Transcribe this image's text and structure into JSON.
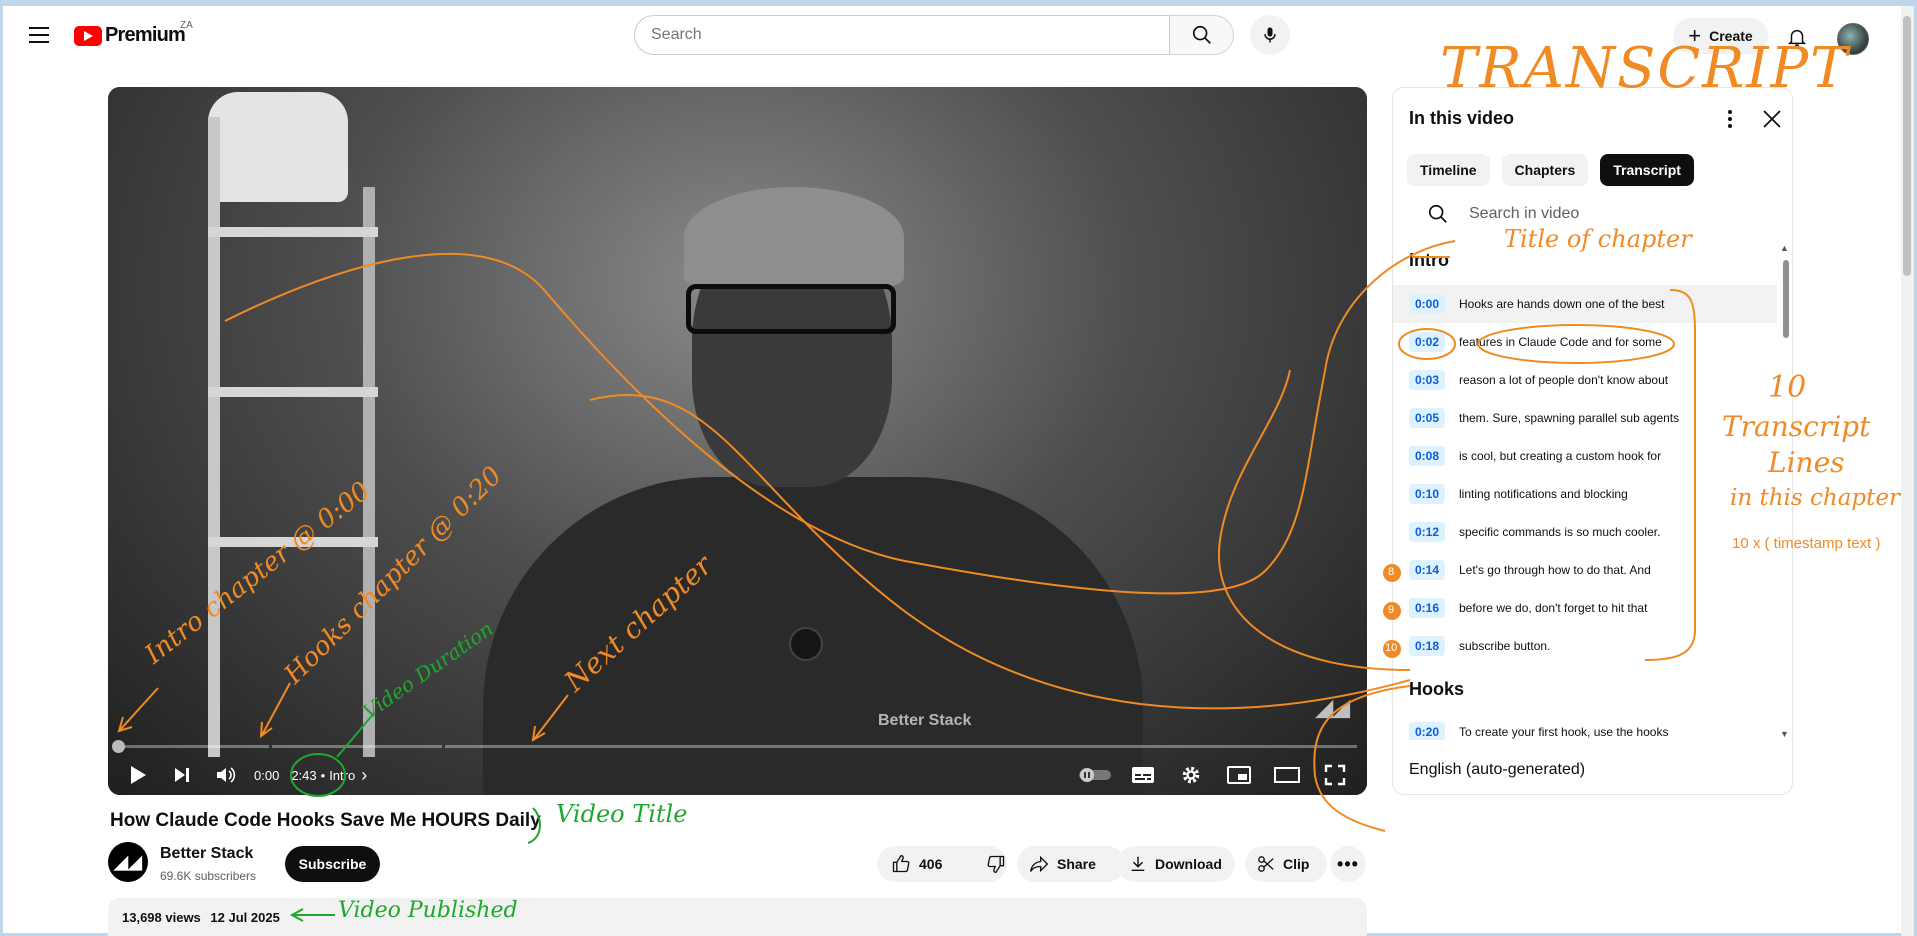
{
  "masthead": {
    "logo_text": "Premium",
    "country_code": "ZA",
    "search_placeholder": "Search",
    "create_label": "Create"
  },
  "player": {
    "shirt_logo": "Better Stack",
    "current_time": "0:00",
    "duration": "2:43",
    "separator": "•",
    "chapter": "Intro",
    "chapter_chevron": "›"
  },
  "video": {
    "title": "How Claude Code Hooks Save Me HOURS Daily",
    "channel": "Better Stack",
    "subscribers": "69.6K subscribers",
    "subscribe_label": "Subscribe",
    "likes": "406",
    "share_label": "Share",
    "download_label": "Download",
    "clip_label": "Clip",
    "views": "13,698 views",
    "published": "12 Jul 2025"
  },
  "panel": {
    "title": "In this video",
    "tabs": [
      "Timeline",
      "Chapters",
      "Transcript"
    ],
    "active_tab": "Transcript",
    "search_placeholder": "Search in video",
    "language": "English (auto-generated)",
    "sections": [
      {
        "title": "Intro",
        "lines": [
          {
            "time": "0:00",
            "text": "Hooks are hands down one of the best"
          },
          {
            "time": "0:02",
            "text": "features in Claude Code and for some"
          },
          {
            "time": "0:03",
            "text": "reason a lot of people don't know about"
          },
          {
            "time": "0:05",
            "text": "them. Sure, spawning parallel sub agents"
          },
          {
            "time": "0:08",
            "text": "is cool, but creating a custom hook for"
          },
          {
            "time": "0:10",
            "text": "linting notifications and blocking"
          },
          {
            "time": "0:12",
            "text": "specific commands is so much cooler."
          },
          {
            "time": "0:14",
            "text": "Let's go through how to do that. And"
          },
          {
            "time": "0:16",
            "text": "before we do, don't forget to hit that"
          },
          {
            "time": "0:18",
            "text": "subscribe button."
          }
        ]
      },
      {
        "title": "Hooks",
        "lines": [
          {
            "time": "0:20",
            "text": "To create your first hook, use the hooks"
          }
        ]
      }
    ]
  },
  "annotations": {
    "transcript": "TRANSCRIPT",
    "title_of_chapter": "Title of chapter",
    "ten": "10",
    "transcript_lines": "Transcript",
    "lines": "Lines",
    "in_this_chapter": "in this chapter",
    "formula": "10 x ( timestamp text )",
    "badge_8": "8",
    "badge_9": "9",
    "badge_10": "10",
    "intro_chapter": "Intro chapter @ 0:00",
    "hooks_chapter": "Hooks chapter @ 0:20",
    "next_chapter": "Next chapter",
    "video_duration": "Video Duration",
    "video_title": "Video Title",
    "video_published": "Video Published",
    "colors": {
      "orange": "#f08a24",
      "green": "#1fa82e"
    }
  }
}
